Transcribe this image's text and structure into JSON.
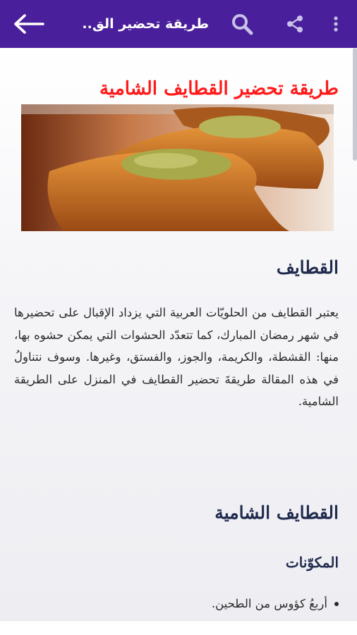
{
  "app_bar": {
    "title": "طريقة تحضير الق..",
    "icons": [
      "back-arrow-icon",
      "search-icon",
      "share-icon",
      "more-vert-icon"
    ],
    "background": "#4a1f9c"
  },
  "article": {
    "title": "طريقة تحضير القطايف الشامية",
    "title_color": "#ff1a1a",
    "section1_heading": "القطايف",
    "intro_paragraph": "يعتبر القطايف من الحلويّات العربية التي يزداد الإقبال على تحضيرها في شهر رمضان المبارك، كما تتعدّد الحشوات التي يمكن حشوه بها، منها: القشطة، والكريمة، والجوز، والفستق، وغيرها. وسوف نتناولُ في هذه المقالة طريقةَ تحضير القطايف في المنزل على الطريقة الشامية.",
    "section2_heading": "القطايف الشامية",
    "ingredients_heading": "المكوّنات",
    "ingredients": [
      "أربعُ كؤوس من الطحين."
    ]
  }
}
